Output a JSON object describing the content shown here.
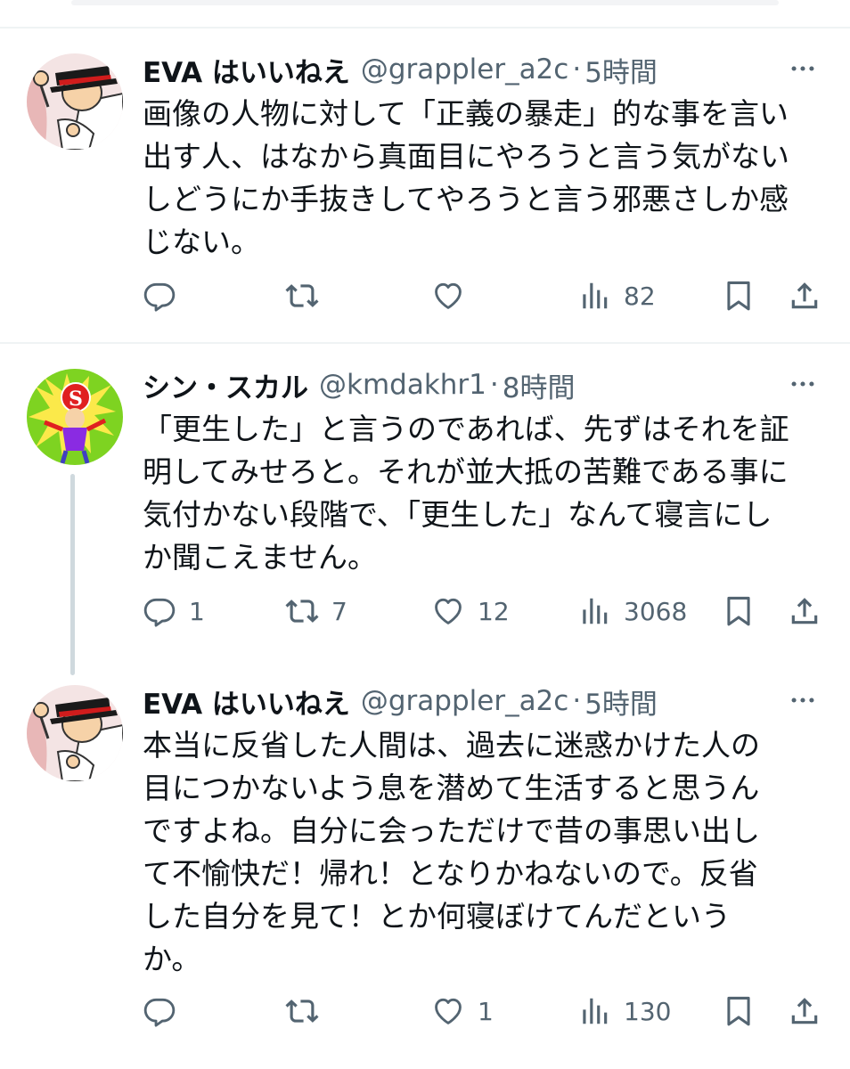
{
  "tweets": [
    {
      "name": "EVA はいいねえ",
      "handle": "@grappler_a2c",
      "dot": "·",
      "time": "5時間",
      "text": "画像の人物に対して「正義の暴走」的な事を言い\n出す人、はなから真面目にやろうと言う気がない\nしどうにか手抜きしてやろうと言う邪悪さしか感\nじない。",
      "reply_count": "",
      "retweet_count": "",
      "like_count": "",
      "view_count": "82",
      "avatar_icon": "hat-character-avatar"
    },
    {
      "name": "シン・スカル",
      "handle": "@kmdakhr1",
      "dot": "·",
      "time": "8時間",
      "text": "「更生した」と言うのであれば、先ずはそれを証\n明してみせろと。それが並大抵の苦難である事に\n気付かない段階で、「更生した」なんて寝言にし\nか聞こえません。",
      "reply_count": "1",
      "retweet_count": "7",
      "like_count": "12",
      "view_count": "3068",
      "avatar_icon": "superhero-s-avatar"
    },
    {
      "name": "EVA はいいねえ",
      "handle": "@grappler_a2c",
      "dot": "·",
      "time": "5時間",
      "text": "本当に反省した人間は、過去に迷惑かけた人の\n目につかないよう息を潜めて生活すると思うん\nですよね。自分に会っただけで昔の事思い出し\nて不愉快だ！帰れ！となりかねないので。反省\nした自分を見て！とか何寝ぼけてんだという\nか。",
      "reply_count": "",
      "retweet_count": "",
      "like_count": "1",
      "view_count": "130",
      "avatar_icon": "hat-character-avatar"
    }
  ],
  "icons": {
    "reply": "reply-icon",
    "retweet": "retweet-icon",
    "like": "like-icon",
    "views": "views-icon",
    "bookmark": "bookmark-icon",
    "share": "share-icon",
    "more": "more-icon"
  },
  "colors": {
    "text": "#0f1419",
    "secondary": "#536471",
    "separator": "#eff3f4",
    "thread_line": "#cfd9de"
  }
}
